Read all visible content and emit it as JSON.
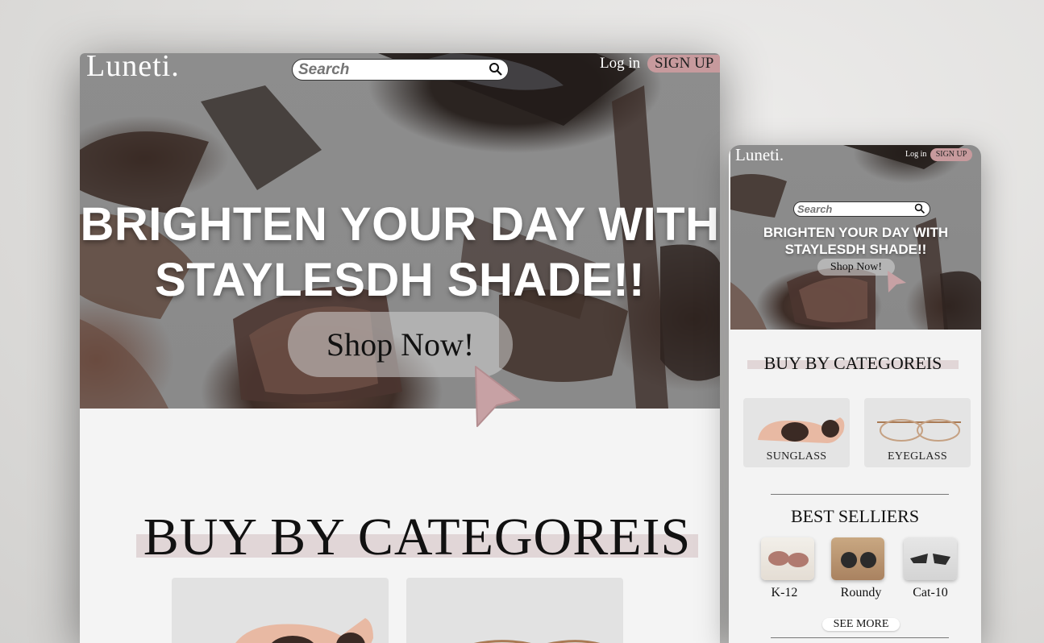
{
  "desktop": {
    "logo": "Luneti.",
    "search_placeholder": "Search",
    "login_label": "Log in",
    "signup_label": "SIGN UP",
    "headline_line1": "BRIGHTEN YOUR DAY WITH",
    "headline_line2": "STAYLESDH SHADE!!",
    "shop_label": "Shop Now!",
    "categories_title": "BUY BY CATEGOREIS"
  },
  "mobile": {
    "logo": "Luneti.",
    "login_label": "Log in",
    "signup_label": "SIGN UP",
    "search_placeholder": "Search",
    "headline_line1": "BRIGHTEN YOUR DAY WITH",
    "headline_line2": "STAYLESDH SHADE!!",
    "shop_label": "Shop Now!",
    "categories_title": "BUY BY CATEGOREIS",
    "categories": [
      {
        "label": "SUNGLASS",
        "icon": "sunglasses-icon"
      },
      {
        "label": "EYEGLASS",
        "icon": "eyeglasses-icon"
      }
    ],
    "best_sellers_title": "BEST SELLIERS",
    "products": [
      {
        "label": "K-12"
      },
      {
        "label": "Roundy"
      },
      {
        "label": "Cat-10"
      }
    ],
    "see_more_label": "SEE MORE"
  },
  "colors": {
    "accent_pink": "#c79a9d",
    "title_bar": "#e1d6d7",
    "hero_gray": "#8c8c8c"
  }
}
